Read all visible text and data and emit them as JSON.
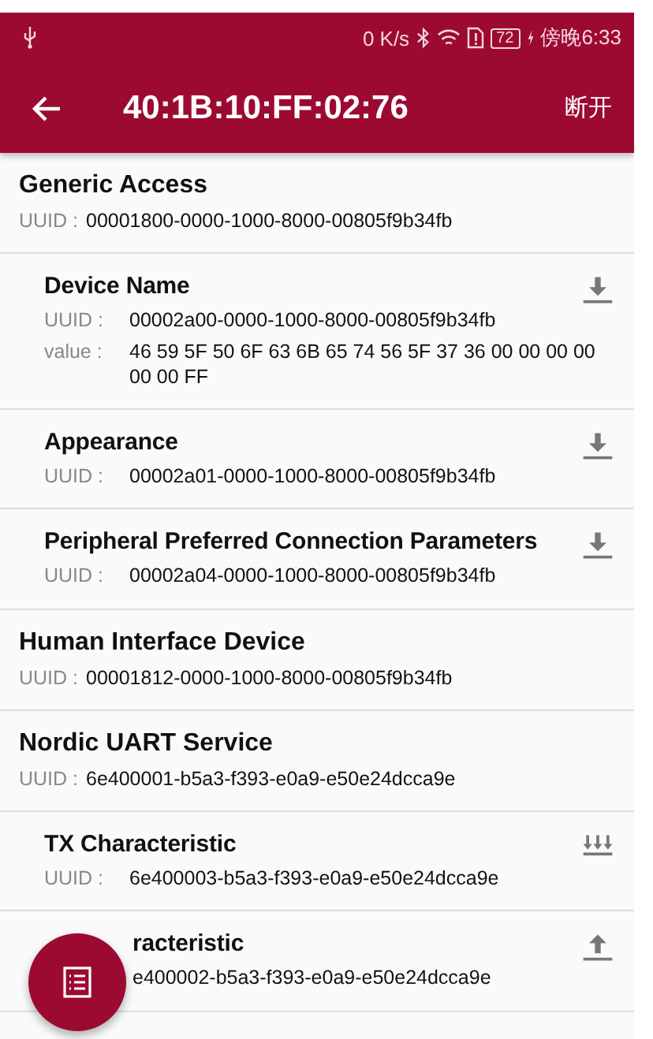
{
  "status_bar": {
    "speed": "0 K/s",
    "battery": "72",
    "time": "傍晚6:33"
  },
  "toolbar": {
    "title": "40:1B:10:FF:02:76",
    "action": "断开"
  },
  "services": [
    {
      "name": "Generic Access",
      "uuid_label": "UUID :",
      "uuid": "00001800-0000-1000-8000-00805f9b34fb",
      "characteristics": [
        {
          "kind": "read",
          "name": "Device Name",
          "uuid_label": "UUID :",
          "uuid": "00002a00-0000-1000-8000-00805f9b34fb",
          "value_label": "value :",
          "value": "46 59 5F 50 6F 63 6B 65 74 56 5F 37 36 00 00 00 00 00 00 FF"
        },
        {
          "kind": "read",
          "name": "Appearance",
          "uuid_label": "UUID :",
          "uuid": "00002a01-0000-1000-8000-00805f9b34fb"
        },
        {
          "kind": "read",
          "name": "Peripheral Preferred Connection Parameters",
          "uuid_label": "UUID :",
          "uuid": "00002a04-0000-1000-8000-00805f9b34fb"
        }
      ]
    },
    {
      "name": "Human Interface Device",
      "uuid_label": "UUID :",
      "uuid": "00001812-0000-1000-8000-00805f9b34fb"
    },
    {
      "name": "Nordic UART Service",
      "uuid_label": "UUID :",
      "uuid": "6e400001-b5a3-f393-e0a9-e50e24dcca9e",
      "characteristics": [
        {
          "kind": "notify",
          "name": "TX Characteristic",
          "uuid_label": "UUID :",
          "uuid": "6e400003-b5a3-f393-e0a9-e50e24dcca9e"
        },
        {
          "kind": "write",
          "covered": true,
          "name": "racteristic",
          "uuid": "e400002-b5a3-f393-e0a9-e50e24dcca9e"
        }
      ]
    }
  ]
}
